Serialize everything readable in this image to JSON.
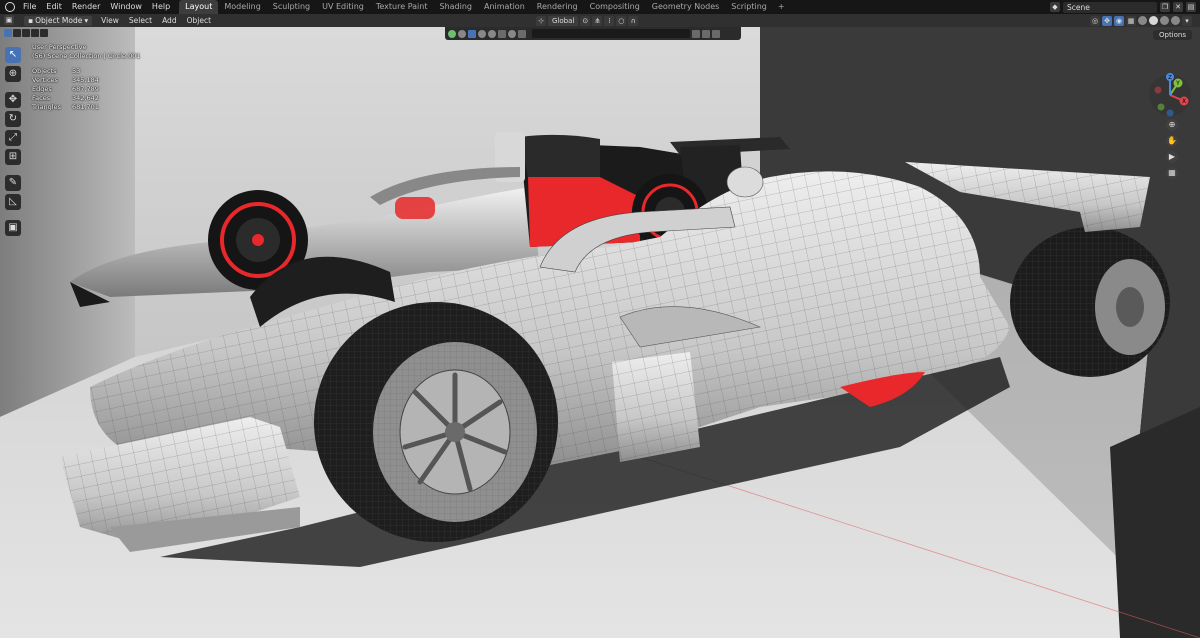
{
  "menu": [
    "File",
    "Edit",
    "Render",
    "Window",
    "Help"
  ],
  "workspace_tabs": [
    "Layout",
    "Modeling",
    "Sculpting",
    "UV Editing",
    "Texture Paint",
    "Shading",
    "Animation",
    "Rendering",
    "Compositing",
    "Geometry Nodes",
    "Scripting"
  ],
  "active_tab": "Layout",
  "tab_add": "+",
  "scene": {
    "name": "Scene"
  },
  "header": {
    "mode": "Object Mode",
    "menus": [
      "View",
      "Select",
      "Add",
      "Object"
    ],
    "orientation": "Global"
  },
  "viewport": {
    "view_name": "User Perspective",
    "collection": "(56) Scene Collection | Circle.001",
    "stats": [
      {
        "label": "Objects",
        "value": "53"
      },
      {
        "label": "Vertices",
        "value": "345,184"
      },
      {
        "label": "Edges",
        "value": "687,789"
      },
      {
        "label": "Faces",
        "value": "342,642"
      },
      {
        "label": "Triangles",
        "value": "681,701"
      }
    ],
    "options_label": "Options",
    "gizmo_axes": {
      "x": "X",
      "y": "Y",
      "z": "Z"
    }
  },
  "colors": {
    "accent": "#4772b3",
    "tyre_red": "#e8282a",
    "axis_x": "#e0444e",
    "axis_y": "#7fc242",
    "axis_z": "#4a8be0"
  }
}
